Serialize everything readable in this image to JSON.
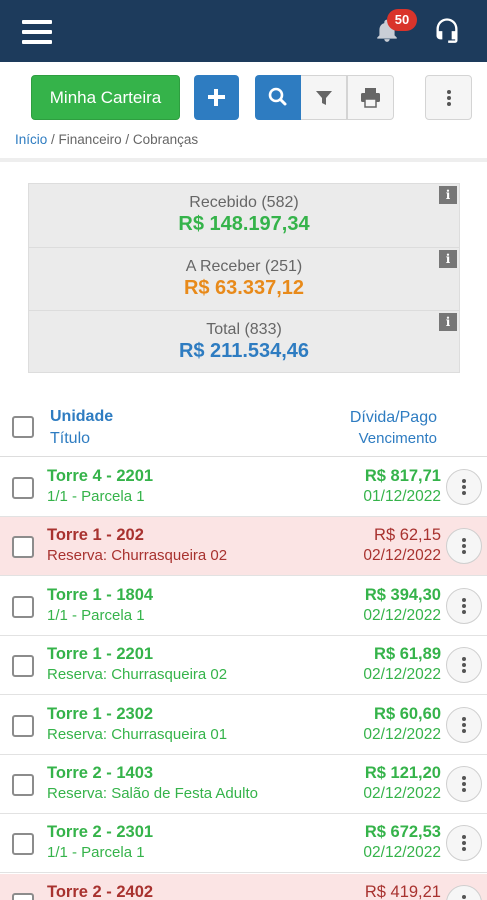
{
  "header": {
    "notifications_count": "50"
  },
  "toolbar": {
    "wallet_label": "Minha Carteira"
  },
  "breadcrumb": {
    "home": "Início",
    "sep1": " / ",
    "finance": "Financeiro",
    "sep2": " / ",
    "current": "Cobranças"
  },
  "summary": {
    "received_label": "Recebido (582)",
    "received_value": "R$ 148.197,34",
    "receivable_label": "A Receber (251)",
    "receivable_value": "R$ 63.337,12",
    "total_label": "Total (833)",
    "total_value": "R$ 211.534,46",
    "info_icon_glyph": "i"
  },
  "colors": {
    "received": "#35b34a",
    "receivable": "#e88a1a",
    "total": "#2e7cc1",
    "topbar": "#1d3b5c",
    "pending_row_bg": "#fbe4e4"
  },
  "list": {
    "header": {
      "unit": "Unidade",
      "title": "Título",
      "debt_paid": "Dívida/Pago",
      "due": "Vencimento"
    },
    "rows": [
      {
        "status": "paid",
        "unit": "Torre 4 - 2201",
        "title": "1/1 - Parcela 1",
        "amount": "R$ 817,71",
        "date": "01/12/2022"
      },
      {
        "status": "pending",
        "unit": "Torre 1 - 202",
        "title": "Reserva: Churrasqueira 02",
        "amount": "R$ 62,15",
        "date": "02/12/2022"
      },
      {
        "status": "paid",
        "unit": "Torre 1 - 1804",
        "title": "1/1 - Parcela 1",
        "amount": "R$ 394,30",
        "date": "02/12/2022"
      },
      {
        "status": "paid",
        "unit": "Torre 1 - 2201",
        "title": "Reserva: Churrasqueira 02",
        "amount": "R$ 61,89",
        "date": "02/12/2022"
      },
      {
        "status": "paid",
        "unit": "Torre 1 - 2302",
        "title": "Reserva: Churrasqueira 01",
        "amount": "R$ 60,60",
        "date": "02/12/2022"
      },
      {
        "status": "paid",
        "unit": "Torre 2 - 1403",
        "title": "Reserva: Salão de Festa Adulto",
        "amount": "R$ 121,20",
        "date": "02/12/2022"
      },
      {
        "status": "paid",
        "unit": "Torre 2 - 2301",
        "title": "1/1 - Parcela 1",
        "amount": "R$ 672,53",
        "date": "02/12/2022"
      },
      {
        "status": "pending",
        "unit": "Torre 2 - 2402",
        "title": "",
        "amount": "R$ 419,21",
        "date": ""
      }
    ]
  }
}
